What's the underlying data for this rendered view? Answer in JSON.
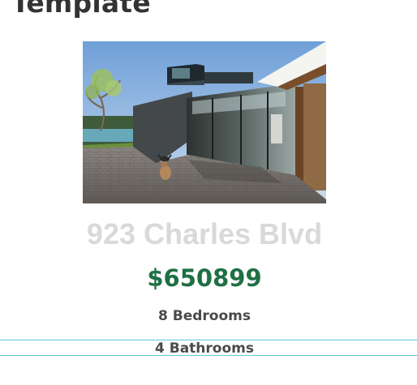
{
  "page": {
    "title": "Template"
  },
  "listing": {
    "address": "923 Charles Blvd",
    "price": "$650899",
    "bedrooms": "8 Bedrooms",
    "bathrooms": "4 Bathrooms"
  },
  "colors": {
    "price": "#1f7045",
    "address": "#d9d9d9",
    "divider": "#5bc7d6",
    "title": "#333333"
  }
}
